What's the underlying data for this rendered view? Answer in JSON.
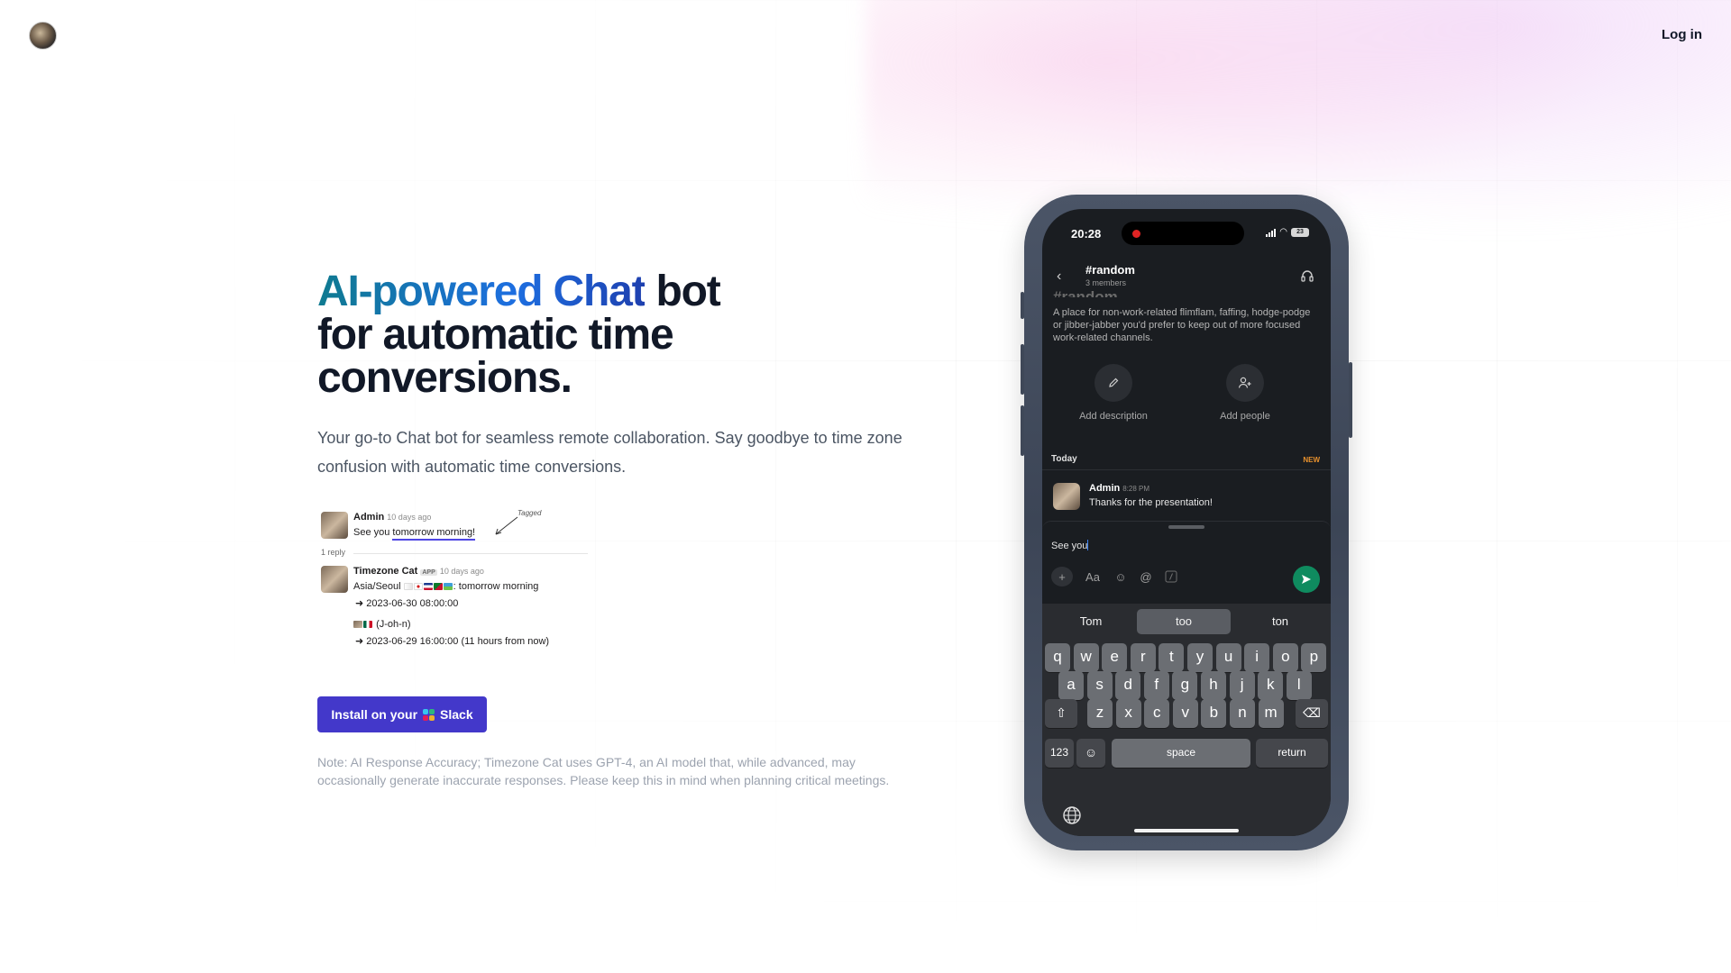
{
  "header": {
    "login_label": "Log in"
  },
  "hero": {
    "title_gradient": "AI-powered Chat",
    "title_rest_line1": " bot",
    "title_line2": "for automatic time",
    "title_line3": "conversions.",
    "subtitle": "Your go-to Chat bot for seamless remote collaboration. Say goodbye to time zone confusion with automatic time conversions."
  },
  "thread": {
    "msg1_author": "Admin",
    "msg1_time": "10 days ago",
    "msg1_text_prefix": "See you ",
    "msg1_text_highlight": "tomorrow morning!",
    "tagged_label": "Tagged",
    "reply_count": "1 reply",
    "msg2_author": "Timezone Cat",
    "msg2_app_badge": "APP",
    "msg2_time": "10 days ago",
    "msg2_zone1_label": "Asia/Seoul",
    "msg2_zone1_suffix": ": tomorrow morning",
    "msg2_zone1_result": "➜ 2023-06-30 08:00:00",
    "msg2_zone2_label": "(J-oh-n)",
    "msg2_zone2_result": "➜ 2023-06-29 16:00:00 (11 hours from now)"
  },
  "install": {
    "label_prefix": "Install on your",
    "label_brand": "Slack"
  },
  "note": "Note: AI Response Accuracy; Timezone Cat uses GPT-4, an AI model that, while advanced, may occasionally generate inaccurate responses. Please keep this in mind when planning critical meetings.",
  "phone": {
    "time": "20:28",
    "battery": "23",
    "channel_name": "#random",
    "channel_members": "3 members",
    "channel_ghost": "#random",
    "channel_description": "A place for non-work-related flimflam, faffing, hodge-podge or jibber-jabber you'd prefer to keep out of more focused work-related channels.",
    "action_add_description": "Add description",
    "action_add_people": "Add people",
    "today_label": "Today",
    "new_label": "NEW",
    "message_author": "Admin",
    "message_time": "8:28 PM",
    "message_text": "Thanks for the presentation!",
    "composer_text": "See you",
    "format_label": "Aa",
    "mention_label": "@",
    "suggestions": [
      "Tom",
      "too",
      "ton"
    ],
    "keys_row1": [
      "q",
      "w",
      "e",
      "r",
      "t",
      "y",
      "u",
      "i",
      "o",
      "p"
    ],
    "keys_row2": [
      "a",
      "s",
      "d",
      "f",
      "g",
      "h",
      "j",
      "k",
      "l"
    ],
    "keys_row3": [
      "z",
      "x",
      "c",
      "v",
      "b",
      "n",
      "m"
    ],
    "key_123": "123",
    "key_space": "space",
    "key_return": "return"
  },
  "colors": {
    "accent": "#4338ca",
    "gradient_start": "#0f7a90",
    "gradient_end": "#1e40af",
    "send_button": "#0f8b5f",
    "new_badge": "#e8912d"
  }
}
